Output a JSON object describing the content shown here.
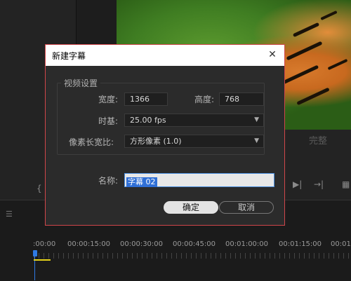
{
  "background": {
    "complete_label": "完整",
    "timecodes": [
      ":00:00",
      "00:00:15:00",
      "00:00:30:00",
      "00:00:45:00",
      "00:01:00:00",
      "00:01:15:00",
      "00:01:"
    ]
  },
  "dialog": {
    "title": "新建字幕",
    "group_title": "视频设置",
    "width_label": "宽度:",
    "width_value": "1366",
    "height_label": "高度:",
    "height_value": "768",
    "timebase_label": "时基:",
    "timebase_value": "25.00 fps",
    "pixel_aspect_label": "像素长宽比:",
    "pixel_aspect_value": "方形像素 (1.0)",
    "name_label": "名称:",
    "name_value": "字幕 02",
    "ok_label": "确定",
    "cancel_label": "取消"
  },
  "colors": {
    "accent": "#2f7ae5",
    "dialog_border": "#d0464a",
    "work_area": "#e6d21a"
  }
}
